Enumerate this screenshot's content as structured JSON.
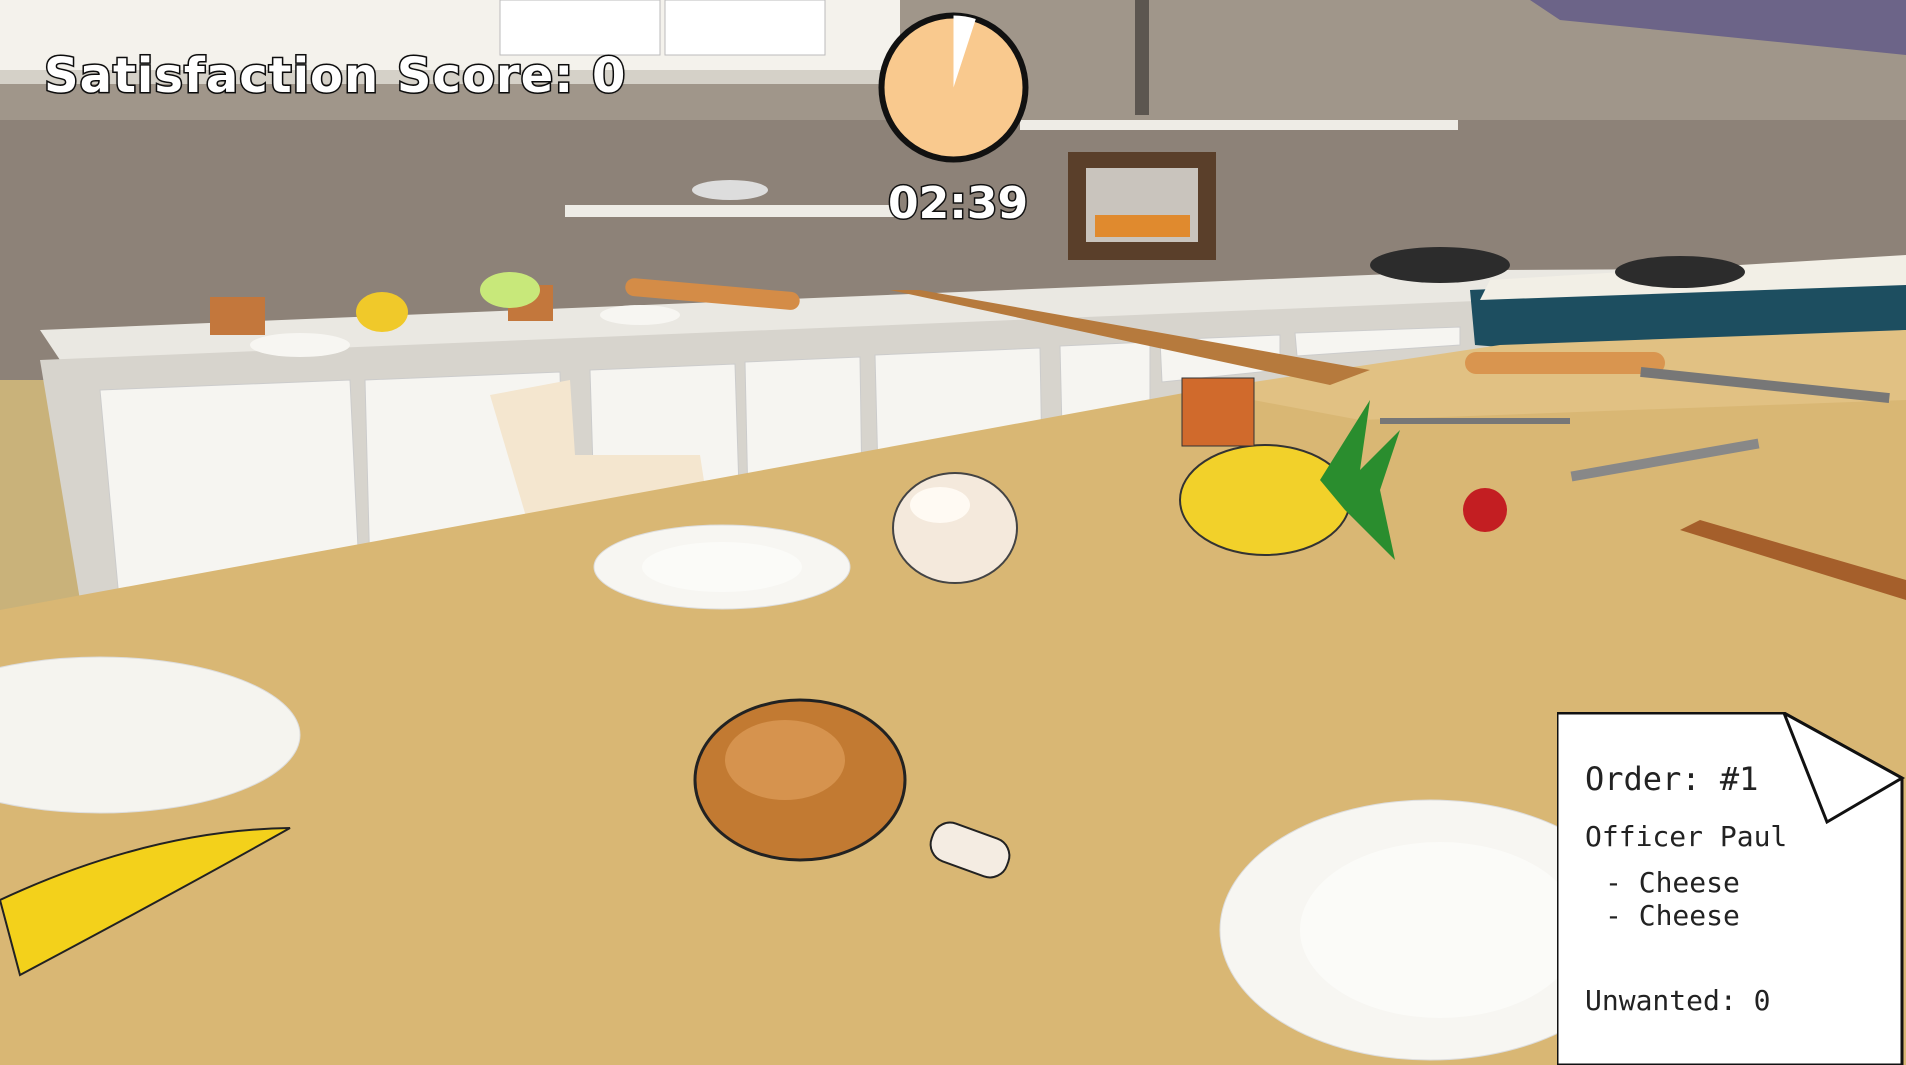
{
  "hud": {
    "score_label": "Satisfaction Score: 0",
    "timer_text": "02:39",
    "timer_fraction_elapsed": 0.05
  },
  "order": {
    "title": "Order: #1",
    "customer": "Officer Paul",
    "items": [
      "- Cheese",
      "- Cheese"
    ],
    "unwanted": "Unwanted: 0"
  },
  "colors": {
    "table": "#d9b774",
    "timer_fill": "#f9c98e",
    "wall": "#8a7e74",
    "cabinet": "#f2f0ea"
  }
}
